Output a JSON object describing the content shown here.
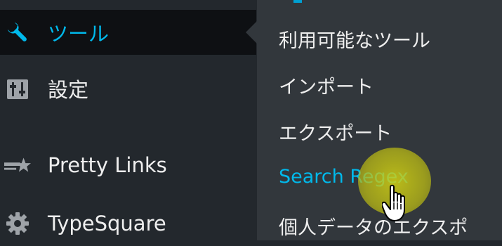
{
  "sidebar": {
    "items": [
      {
        "label": "ツール",
        "icon": "wrench-icon",
        "active": true
      },
      {
        "label": "設定",
        "icon": "settings-sliders-icon"
      },
      {
        "label": "Pretty Links",
        "icon": "pretty-links-star-icon"
      },
      {
        "label": "TypeSquare",
        "icon": "gear-icon"
      }
    ]
  },
  "submenu": {
    "items": [
      {
        "label": "利用可能なツール"
      },
      {
        "label": "インポート"
      },
      {
        "label": "エクスポート"
      },
      {
        "label": "Search Regex",
        "current": true
      },
      {
        "label": "個人データのエクスポ"
      }
    ]
  },
  "colors": {
    "sidebar_bg": "#23282d",
    "active_bg": "#0e1013",
    "submenu_bg": "#32373c",
    "accent": "#00b9eb",
    "text": "#eeeeee",
    "highlight": "#d2d214"
  }
}
